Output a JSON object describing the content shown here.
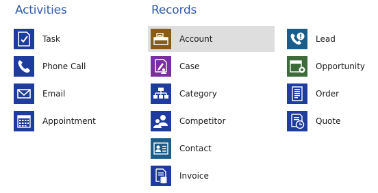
{
  "activities": {
    "heading": "Activities",
    "items": [
      {
        "label": "Task",
        "icon": "task-checkbox-icon",
        "color": "#1e3b9e"
      },
      {
        "label": "Phone Call",
        "icon": "phone-icon",
        "color": "#1e3b9e"
      },
      {
        "label": "Email",
        "icon": "envelope-icon",
        "color": "#1e3b9e"
      },
      {
        "label": "Appointment",
        "icon": "calendar-icon",
        "color": "#1e3b9e"
      }
    ]
  },
  "records": {
    "heading": "Records",
    "column1": [
      {
        "label": "Account",
        "icon": "account-folder-icon",
        "color": "#8a5a1b",
        "selected": true
      },
      {
        "label": "Case",
        "icon": "case-icon",
        "color": "#7b2f9e"
      },
      {
        "label": "Category",
        "icon": "hierarchy-icon",
        "color": "#1e3b9e"
      },
      {
        "label": "Competitor",
        "icon": "competitor-people-icon",
        "color": "#1e3b9e"
      },
      {
        "label": "Contact",
        "icon": "contact-card-icon",
        "color": "#1a5c8a"
      },
      {
        "label": "Invoice",
        "icon": "invoice-icon",
        "color": "#1e3b9e"
      }
    ],
    "column2": [
      {
        "label": "Lead",
        "icon": "lead-phone-icon",
        "color": "#1a5c8a"
      },
      {
        "label": "Opportunity",
        "icon": "opportunity-icon",
        "color": "#3d6b3a"
      },
      {
        "label": "Order",
        "icon": "order-document-icon",
        "color": "#1e3b9e"
      },
      {
        "label": "Quote",
        "icon": "quote-clock-icon",
        "color": "#1e3b9e"
      }
    ]
  }
}
